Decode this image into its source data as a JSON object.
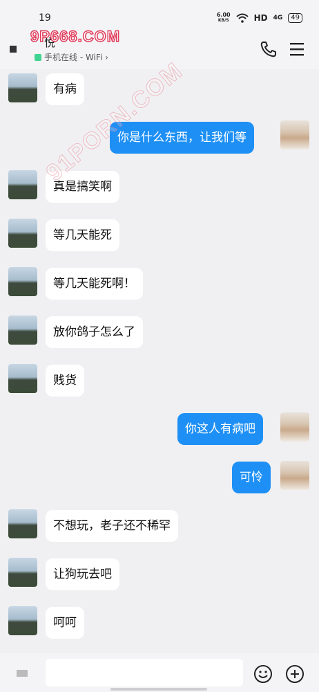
{
  "status_bar": {
    "time": "19",
    "net_speed": "6.00",
    "net_unit": "KB/S",
    "hd_label": "HD",
    "signal_label": "4G",
    "battery": "49"
  },
  "header": {
    "contact_name": "悦",
    "online_status": "手机在线 - WiFi ›",
    "watermark": "9P668.COM"
  },
  "watermark_diagonal": "91PORN.COM",
  "messages": [
    {
      "side": "left",
      "text": "有病"
    },
    {
      "side": "right",
      "text": "你是什么东西，让我们等"
    },
    {
      "side": "left",
      "text": "真是搞笑啊"
    },
    {
      "side": "left",
      "text": "等几天能死"
    },
    {
      "side": "left",
      "text": "等几天能死啊！"
    },
    {
      "side": "left",
      "text": "放你鸽子怎么了"
    },
    {
      "side": "left",
      "text": "贱货"
    },
    {
      "side": "right",
      "text": "你这人有病吧"
    },
    {
      "side": "right",
      "text": "可怜"
    },
    {
      "side": "left",
      "text": "不想玩，老子还不稀罕"
    },
    {
      "side": "left",
      "text": "让狗玩去吧"
    },
    {
      "side": "left",
      "text": "呵呵"
    }
  ],
  "input": {
    "placeholder": ""
  },
  "icons": {
    "back": "back-icon",
    "phone": "phone-icon",
    "menu": "menu-icon",
    "voice": "voice-icon",
    "emoji": "emoji-icon",
    "plus": "plus-icon"
  },
  "colors": {
    "sent_bubble": "#1e90f5",
    "received_bubble": "#ffffff",
    "background": "#f0f0f2",
    "online": "#41d391"
  }
}
